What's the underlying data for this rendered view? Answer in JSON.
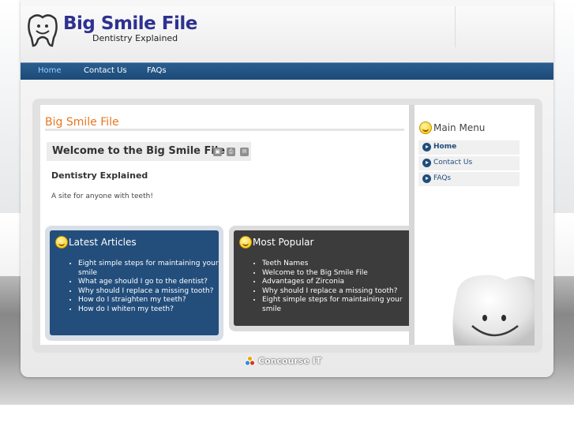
{
  "site": {
    "name": "Big Smile File",
    "tagline": "Dentistry Explained"
  },
  "nav": {
    "items": [
      {
        "label": "Home",
        "active": true
      },
      {
        "label": "Contact Us",
        "active": false
      },
      {
        "label": "FAQs",
        "active": false
      }
    ]
  },
  "main": {
    "section_title": "Big Smile File",
    "article_title": "Welcome to the Big Smile File",
    "tools": [
      "pdf-icon",
      "print-icon",
      "email-icon"
    ],
    "subtitle": "Dentistry Explained",
    "intro": "A site for anyone with teeth!"
  },
  "latest": {
    "heading": "Latest Articles",
    "items": [
      "Eight simple steps for maintaining your smile",
      "What age should I go to the dentist?",
      "Why should I replace a missing tooth?",
      "How do I straighten my teeth?",
      "How do I whiten my teeth?"
    ]
  },
  "popular": {
    "heading": "Most Popular",
    "items": [
      "Teeth Names",
      "Welcome to the Big Smile File",
      "Advantages of Zirconia",
      "Why should I replace a missing tooth?",
      "Eight simple steps for maintaining your smile"
    ]
  },
  "side_menu": {
    "heading": "Main Menu",
    "items": [
      {
        "label": "Home",
        "active": true
      },
      {
        "label": "Contact Us",
        "active": false
      },
      {
        "label": "FAQs",
        "active": false
      }
    ]
  },
  "footer": {
    "brand": "Concourse IT"
  },
  "colors": {
    "nav_bg": "#1c4a78",
    "accent_orange": "#e9761e",
    "brand_blue": "#2e3190",
    "latest_bg": "#234e7c",
    "popular_bg": "#3c3c3c"
  }
}
